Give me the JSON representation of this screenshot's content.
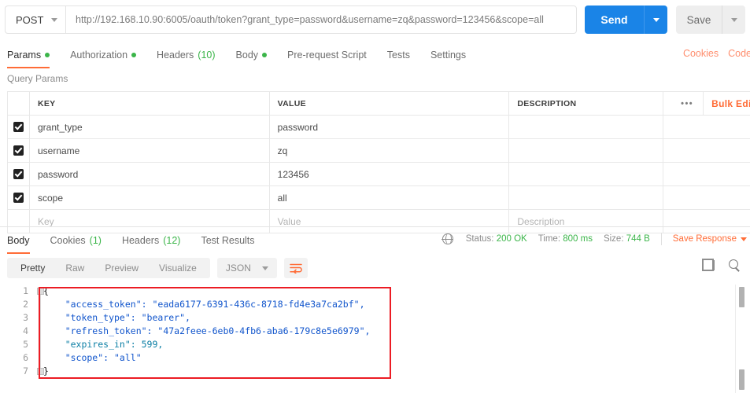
{
  "request": {
    "method": "POST",
    "url": "http://192.168.10.90:6005/oauth/token?grant_type=password&username=zq&password=123456&scope=all",
    "send_label": "Send",
    "save_label": "Save",
    "tabs": [
      {
        "label": "Params",
        "marker": "dot",
        "active": true
      },
      {
        "label": "Authorization",
        "marker": "dot",
        "active": false
      },
      {
        "label": "Headers",
        "count": "(10)",
        "active": false
      },
      {
        "label": "Body",
        "marker": "dot",
        "active": false
      },
      {
        "label": "Pre-request Script",
        "active": false
      },
      {
        "label": "Tests",
        "active": false
      },
      {
        "label": "Settings",
        "active": false
      }
    ],
    "tabs_right": [
      {
        "label": "Cookies"
      },
      {
        "label": "Code"
      }
    ]
  },
  "params": {
    "section_label": "Query Params",
    "headers": {
      "key": "KEY",
      "value": "VALUE",
      "description": "DESCRIPTION",
      "more": "•••",
      "bulk_edit": "Bulk Edit"
    },
    "rows": [
      {
        "checked": true,
        "key": "grant_type",
        "value": "password",
        "description": ""
      },
      {
        "checked": true,
        "key": "username",
        "value": "zq",
        "description": ""
      },
      {
        "checked": true,
        "key": "password",
        "value": "123456",
        "description": ""
      },
      {
        "checked": true,
        "key": "scope",
        "value": "all",
        "description": ""
      }
    ],
    "placeholder_row": {
      "key": "Key",
      "value": "Value",
      "description": "Description"
    }
  },
  "response": {
    "tabs": [
      {
        "label": "Body",
        "count": "",
        "active": true
      },
      {
        "label": "Cookies",
        "count": "(1)",
        "active": false
      },
      {
        "label": "Headers",
        "count": "(12)",
        "active": false
      },
      {
        "label": "Test Results",
        "count": "",
        "active": false
      }
    ],
    "meta": {
      "status_label": "Status:",
      "status_value": "200 OK",
      "time_label": "Time:",
      "time_value": "800 ms",
      "size_label": "Size:",
      "size_value": "744 B",
      "save_response": "Save Response"
    },
    "toolbar": {
      "views": [
        {
          "label": "Pretty",
          "active": true
        },
        {
          "label": "Raw",
          "active": false
        },
        {
          "label": "Preview",
          "active": false
        },
        {
          "label": "Visualize",
          "active": false
        }
      ],
      "format": "JSON"
    },
    "body_lines": [
      {
        "n": "1",
        "text": "{"
      },
      {
        "n": "2",
        "text": "    \"access_token\": \"eada6177-6391-436c-8718-fd4e3a7ca2bf\","
      },
      {
        "n": "3",
        "text": "    \"token_type\": \"bearer\","
      },
      {
        "n": "4",
        "text": "    \"refresh_token\": \"47a2feee-6eb0-4fb6-aba6-179c8e5e6979\","
      },
      {
        "n": "5",
        "text": "    \"expires_in\": 599,"
      },
      {
        "n": "6",
        "text": "    \"scope\": \"all\""
      },
      {
        "n": "7",
        "text": "}"
      }
    ],
    "body_json": {
      "access_token": "eada6177-6391-436c-8718-fd4e3a7ca2bf",
      "token_type": "bearer",
      "refresh_token": "47a2feee-6eb0-4fb6-aba6-179c8e5e6979",
      "expires_in": 599,
      "scope": "all"
    }
  },
  "colors": {
    "accent": "#ff6c37",
    "send": "#1a84e7",
    "success": "#3bb549",
    "annotation": "#ec1c24"
  }
}
